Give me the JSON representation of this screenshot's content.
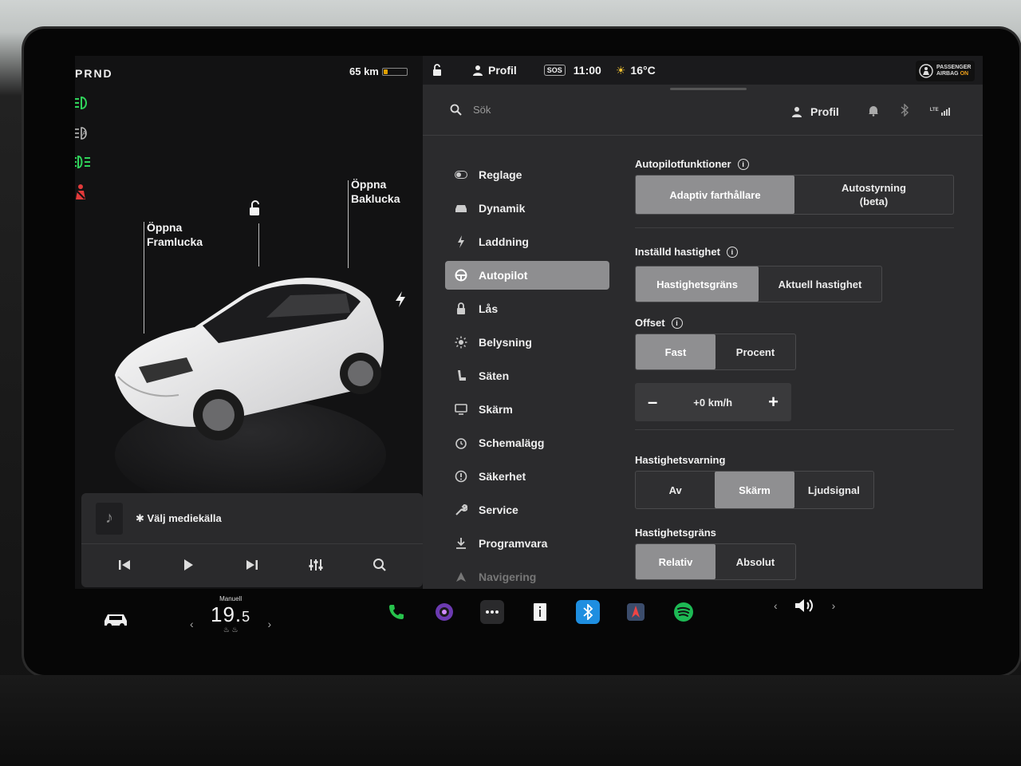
{
  "car": {
    "gear": "PRND",
    "range": "65 km",
    "battery_level": 0.15,
    "frunk_label_1": "Öppna",
    "frunk_label_2": "Framlucka",
    "trunk_label_1": "Öppna",
    "trunk_label_2": "Baklucka"
  },
  "media": {
    "source_label": "Välj mediekälla"
  },
  "status_bar": {
    "profile": "Profil",
    "sos": "SOS",
    "time": "11:00",
    "temperature": "16°C",
    "airbag_line1": "PASSENGER",
    "airbag_line2": "AIRBAG",
    "airbag_state": "ON"
  },
  "topbar": {
    "search_placeholder": "Sök",
    "profile": "Profil",
    "lte": "LTE"
  },
  "nav": {
    "items": [
      {
        "label": "Reglage",
        "icon": "toggle-icon"
      },
      {
        "label": "Dynamik",
        "icon": "car-icon"
      },
      {
        "label": "Laddning",
        "icon": "bolt-icon"
      },
      {
        "label": "Autopilot",
        "icon": "steering-wheel-icon"
      },
      {
        "label": "Lås",
        "icon": "lock-icon"
      },
      {
        "label": "Belysning",
        "icon": "sun-icon"
      },
      {
        "label": "Säten",
        "icon": "seat-icon"
      },
      {
        "label": "Skärm",
        "icon": "display-icon"
      },
      {
        "label": "Schemalägg",
        "icon": "clock-icon"
      },
      {
        "label": "Säkerhet",
        "icon": "alert-circle-icon"
      },
      {
        "label": "Service",
        "icon": "wrench-icon"
      },
      {
        "label": "Programvara",
        "icon": "download-icon"
      },
      {
        "label": "Navigering",
        "icon": "navigation-arrow-icon"
      }
    ],
    "active_index": 3
  },
  "autopilot": {
    "features_title": "Autopilotfunktioner",
    "features_options": [
      "Adaptiv farthållare",
      "Autostyrning (beta)"
    ],
    "features_selected": 0,
    "set_speed_title": "Inställd hastighet",
    "set_speed_options": [
      "Hastighetsgräns",
      "Aktuell hastighet"
    ],
    "set_speed_selected": 0,
    "offset_title": "Offset",
    "offset_options": [
      "Fast",
      "Procent"
    ],
    "offset_selected": 0,
    "offset_value": "+0 km/h",
    "minus": "–",
    "plus": "+",
    "speed_warning_title": "Hastighetsvarning",
    "speed_warning_options": [
      "Av",
      "Skärm",
      "Ljudsignal"
    ],
    "speed_warning_selected": 1,
    "speed_limit_title": "Hastighetsgräns",
    "speed_limit_options": [
      "Relativ",
      "Absolut"
    ],
    "speed_limit_selected": 0
  },
  "climate": {
    "mode": "Manuell",
    "temp_whole": "19.",
    "temp_decimal": "5",
    "left_arrow": "‹",
    "right_arrow": "›"
  },
  "volume": {
    "left_arrow": "‹",
    "right_arrow": "›"
  },
  "colors": {
    "accent_selected": "#8f8f91",
    "headlight_green": "#2fd35a",
    "seatbelt_red": "#e23a3a",
    "phone_green": "#27c24c",
    "spotify_green": "#1db954",
    "bluetooth_blue": "#1e8ee0"
  }
}
